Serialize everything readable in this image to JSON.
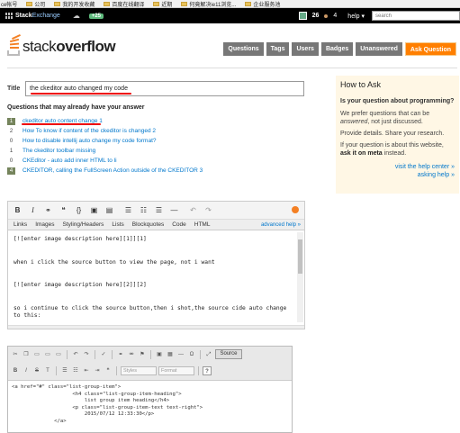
{
  "browser_bookmarks": [
    {
      "label": "ce帐号"
    },
    {
      "label": "公司"
    },
    {
      "label": "我的开发收藏"
    },
    {
      "label": "百度在线翻译"
    },
    {
      "label": "近期"
    },
    {
      "label": "何竟解决ie11浏览..."
    },
    {
      "label": "企业服务池"
    }
  ],
  "topbar": {
    "brand_bold": "Stack",
    "brand_light": "Exchange",
    "rep_change": "+25",
    "reputation": "26",
    "bronze_badges": "4",
    "help": "help ▾",
    "search_placeholder": "search"
  },
  "header": {
    "logo_prefix": "stack",
    "logo_suffix": "overflow",
    "nav": [
      "Questions",
      "Tags",
      "Users",
      "Badges",
      "Unanswered",
      "Ask Question"
    ]
  },
  "ask_form": {
    "title_label": "Title",
    "title_value": "the ckeditor auto changed my code",
    "similar_heading": "Questions that may already have your answer",
    "similar": [
      {
        "count": "1",
        "answered": true,
        "title": "ckeditor auto content change 1"
      },
      {
        "count": "2",
        "answered": false,
        "title": "How To know if content of the ckeditor is changed 2"
      },
      {
        "count": "0",
        "answered": false,
        "title": "How to disable intellij auto change my code format?"
      },
      {
        "count": "1",
        "answered": false,
        "title": "The ckeditor toolbar missing"
      },
      {
        "count": "0",
        "answered": false,
        "title": "CKEditor - auto add inner HTML to li"
      },
      {
        "count": "4",
        "answered": true,
        "title": "CKEDITOR, calling the FullScreen Action outside of the CKEDITOR 3"
      }
    ]
  },
  "editor": {
    "tabs": [
      "Links",
      "Images",
      "Styling/Headers",
      "Lists",
      "Blockquotes",
      "Code",
      "HTML"
    ],
    "advanced_help": "advanced help »",
    "body_lines": [
      "[![enter image description here][1]][1]",
      "",
      "",
      "when i click the source button to view the page, not i want",
      "",
      "",
      "[![enter image description here][2]][2]",
      "",
      "",
      "so i continue to click the source button,then i shot,the source cide auto change",
      "to this:"
    ]
  },
  "how_to_ask": {
    "title": "How to Ask",
    "question": "Is your question about programming?",
    "p1_a": "We prefer questions that can be ",
    "p1_em": "answered",
    "p1_b": ", not just discussed.",
    "p2": "Provide details. Share your research.",
    "p3_a": "If your question is about this website, ",
    "p3_b": "ask it on meta",
    "p3_c": " instead.",
    "link1": "visit the help center »",
    "link2": "asking help »"
  },
  "ckeditor_shot": {
    "source_label": "Source",
    "styles_label": "Styles",
    "format_label": "Format",
    "code_lines": [
      "<a href=\"#\" class=\"list-group-item\">",
      "                    <h4 class=\"list-group-item-heading\">",
      "                        list group item heading</h4>",
      "                    <p class=\"list-group-item-text text-right\">",
      "                        2015/07/12 12:33:30</p>",
      "              </a>"
    ]
  },
  "colors": {
    "so_orange": "#f48024",
    "ask_button": "#ff7f00",
    "nav_gray": "#777777",
    "link_blue": "#0077cc",
    "answered_green": "#75845c",
    "how_to_ask_bg": "#fff7e5",
    "annotation_red": "#e00000"
  }
}
